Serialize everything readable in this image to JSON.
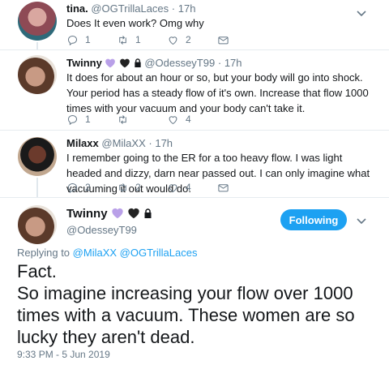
{
  "tweets": [
    {
      "name": "tina.",
      "handle": "@OGTrillaLaces",
      "sep": "·",
      "time": "17h",
      "text": "Does It even work? Omg why",
      "replies": "1",
      "retweets": "1",
      "likes": "2"
    },
    {
      "name": "Twinny",
      "handle": "@OdesseyT99",
      "sep": "·",
      "time": "17h",
      "text": "It does for about an hour or so, but your body will go into shock. Your period has a steady flow of it's own. Increase that flow 1000 times with your vacuum and your body can't take it.",
      "replies": "1",
      "retweets": "",
      "likes": "4"
    },
    {
      "name": "Milaxx",
      "handle": "@MilaXX",
      "sep": "·",
      "time": "17h",
      "text": "I remember going to the ER for a too heavy flow. I was light headed and dizzy, darn near passed out. I can only imagine what vacuuming it out would do.",
      "replies": "2",
      "retweets": "2",
      "likes": "4"
    }
  ],
  "main": {
    "name": "Twinny",
    "handle": "@OdesseyT99",
    "follow_label": "Following",
    "replying_prefix": "Replying to",
    "replying_to": "@MilaXX @OGTrillaLaces",
    "text": "Fact.\nSo imagine increasing your flow over 1000 times with a vacuum. These women are so lucky they aren't dead.",
    "timestamp": "9:33 PM - 5 Jun 2019"
  },
  "colors": {
    "accent": "#1da1f2",
    "heart_purple": "#b9a0e8",
    "heart_black": "#222222"
  },
  "icons": [
    "reply-icon",
    "retweet-icon",
    "like-icon",
    "dm-icon",
    "lock-icon",
    "purple-heart-emoji",
    "black-heart-emoji",
    "chevron-down-icon"
  ]
}
